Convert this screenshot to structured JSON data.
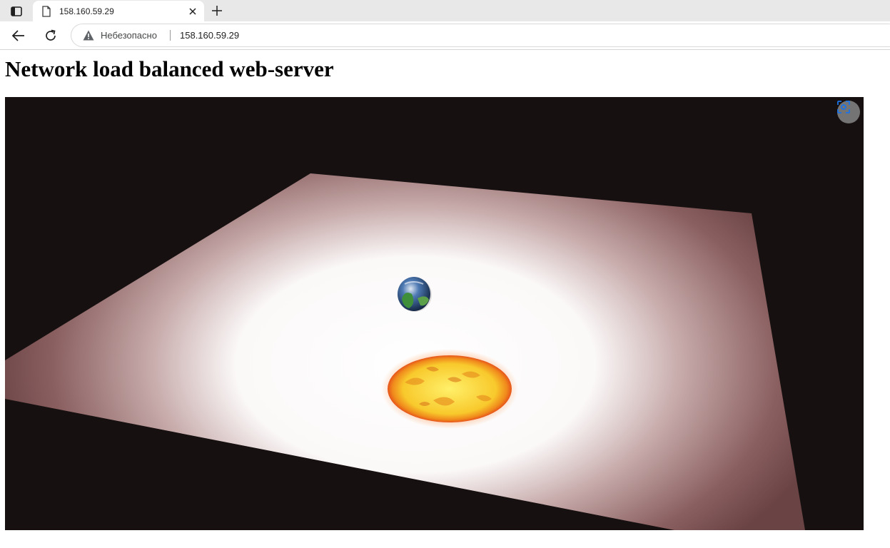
{
  "browser": {
    "tab": {
      "title": "158.160.59.29"
    },
    "address_bar": {
      "security_label": "Небезопасно",
      "url": "158.160.59.29"
    }
  },
  "page": {
    "heading": "Network load balanced web-server"
  },
  "icons": {
    "tab_actions": "tab-actions-icon",
    "favicon": "page-icon",
    "close": "close-icon",
    "new_tab": "plus-icon",
    "back": "back-arrow-icon",
    "reload": "reload-icon",
    "security": "warning-icon",
    "capture": "screen-capture-icon"
  },
  "colors": {
    "video_background": "#171010",
    "sun": "#f5b52a",
    "earth": "#2a6fa8",
    "fabric_center": "#ffffff",
    "fabric_edge": "#7a4f4f"
  }
}
